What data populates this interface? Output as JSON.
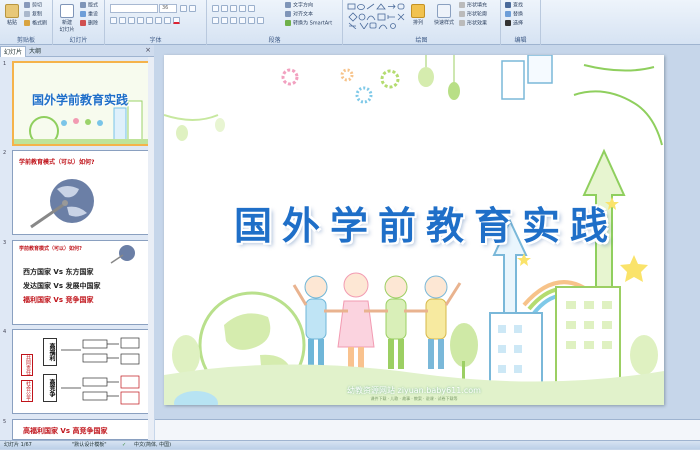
{
  "ribbon": {
    "clipboard": {
      "group": "剪贴板",
      "paste": "粘贴",
      "cut": "剪切",
      "copy": "复制",
      "format_painter": "格式刷"
    },
    "slides": {
      "group": "幻灯片",
      "new_slide": "新建\n幻灯片",
      "layout": "版式",
      "reset": "重设",
      "delete": "删除"
    },
    "font": {
      "group": "字体",
      "font_name": "",
      "font_size": "36"
    },
    "paragraph": {
      "group": "段落",
      "text_direction": "文字方向",
      "align_text": "对齐文本",
      "smartart": "转换为 SmartArt"
    },
    "drawing": {
      "group": "绘图",
      "arrange": "排列",
      "quick_styles": "快速样式",
      "shape_fill": "形状填充",
      "shape_outline": "形状轮廓",
      "shape_effects": "形状效果"
    },
    "editing": {
      "group": "编辑",
      "find": "查找",
      "replace": "替换",
      "select": "选择"
    }
  },
  "left_pane": {
    "tab_slides": "幻灯片",
    "tab_outline": "大纲",
    "close": "×"
  },
  "thumbs": [
    {
      "num": "1",
      "title": "国外学前教育实践"
    },
    {
      "num": "2",
      "title": "学前教育模式（可以）如何?"
    },
    {
      "num": "3",
      "title": "学前教育模式（可以）如何?",
      "lines": [
        "西方国家  Vs  东方国家",
        "发达国家  Vs  发展中国家",
        "福利国家  Vs  竞争国家"
      ]
    },
    {
      "num": "4",
      "boxes": [
        "高福利",
        "高竞争",
        "共同责任",
        "社会公平"
      ]
    },
    {
      "num": "5",
      "title": "高福利国家  Vs  高竞争国家"
    }
  ],
  "slide": {
    "title": "国外学前教育实践",
    "watermark": "幼教资源网站  ziyuan.baby611.com",
    "watermark_sub": "课件下载 · 儿歌 · 故事 · 教案 · 说课 · 试卷下载等"
  },
  "status": {
    "slide_info": "幻灯片 1/67",
    "theme": "\"默认设计模板\"",
    "language": "中文(简体, 中国)"
  },
  "colors": {
    "title": "#1f6fc8",
    "accent": "#7fc241",
    "ribbon": "#dbe6f4"
  }
}
